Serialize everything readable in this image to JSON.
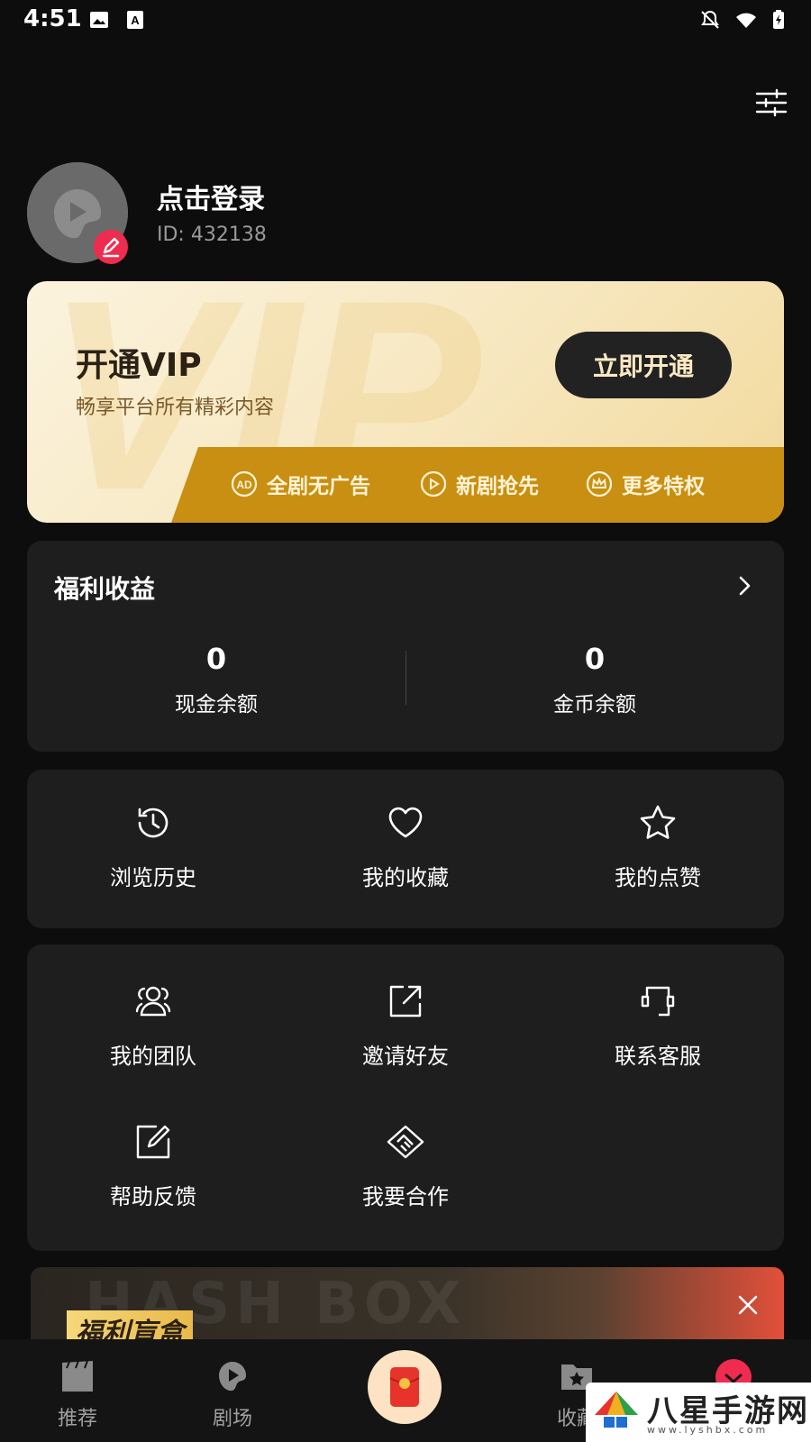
{
  "status_bar": {
    "time": "4:51"
  },
  "profile": {
    "login_label": "点击登录",
    "user_id": "ID: 432138"
  },
  "vip": {
    "title": "开通VIP",
    "subtitle": "畅享平台所有精彩内容",
    "button": "立即开通",
    "perks": [
      "全剧无广告",
      "新剧抢先",
      "更多特权"
    ],
    "colors": {
      "button_bg": "#222222",
      "band": "#c98f12"
    }
  },
  "welfare": {
    "title": "福利收益",
    "cash": {
      "value": "0",
      "label": "现金余额"
    },
    "coins": {
      "value": "0",
      "label": "金币余额"
    }
  },
  "quick_actions": [
    {
      "label": "浏览历史",
      "icon": "history-icon"
    },
    {
      "label": "我的收藏",
      "icon": "heart-icon"
    },
    {
      "label": "我的点赞",
      "icon": "star-icon"
    }
  ],
  "tools": [
    {
      "label": "我的团队",
      "icon": "team-icon"
    },
    {
      "label": "邀请好友",
      "icon": "share-icon"
    },
    {
      "label": "联系客服",
      "icon": "headset-icon"
    },
    {
      "label": "帮助反馈",
      "icon": "edit-icon"
    },
    {
      "label": "我要合作",
      "icon": "handshake-icon"
    }
  ],
  "banner": {
    "bg_text": "HASH BOX",
    "title": "福利盲盒"
  },
  "bottom_nav": [
    {
      "label": "推荐",
      "icon": "clapperboard-icon"
    },
    {
      "label": "剧场",
      "icon": "play-bubble-icon"
    },
    {
      "label": "",
      "icon": "red-envelope-icon"
    },
    {
      "label": "收藏",
      "icon": "folder-star-icon"
    }
  ],
  "watermark": {
    "text": "八星手游网",
    "url": "www.lyshbx.com"
  },
  "accent_color": "#ef2b50"
}
